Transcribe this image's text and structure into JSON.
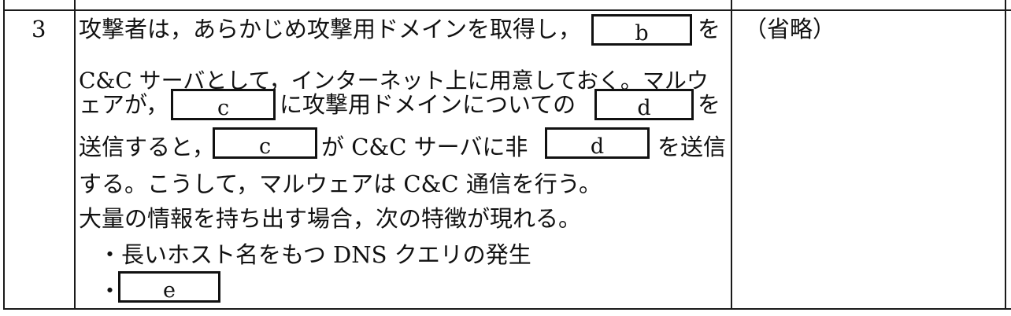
{
  "row": {
    "number": "3",
    "note": "（省略）",
    "lines": {
      "l1_pre": "攻撃者は，あらかじめ攻撃用ドメインを取得し，",
      "l1_post": "を",
      "l2": "C&C サーバとして，インターネット上に用意しておく。マルウ",
      "l3_pre": "ェアが，",
      "l3_mid": "に攻撃用ドメインについての",
      "l3_post": "を",
      "l4_pre": "送信すると，",
      "l4_mid": "が C&C サーバに非",
      "l4_post": "を送信",
      "l5": "する。こうして，マルウェアは C&C 通信を行う。",
      "l6": "大量の情報を持ち出す場合，次の特徴が現れる。",
      "bullet1": "・長いホスト名をもつ DNS クエリの発生",
      "bullet2_dot": "・"
    },
    "blanks": {
      "b": "b",
      "c1": "c",
      "d1": "d",
      "c2": "c",
      "d2": "d",
      "e": "e"
    }
  }
}
